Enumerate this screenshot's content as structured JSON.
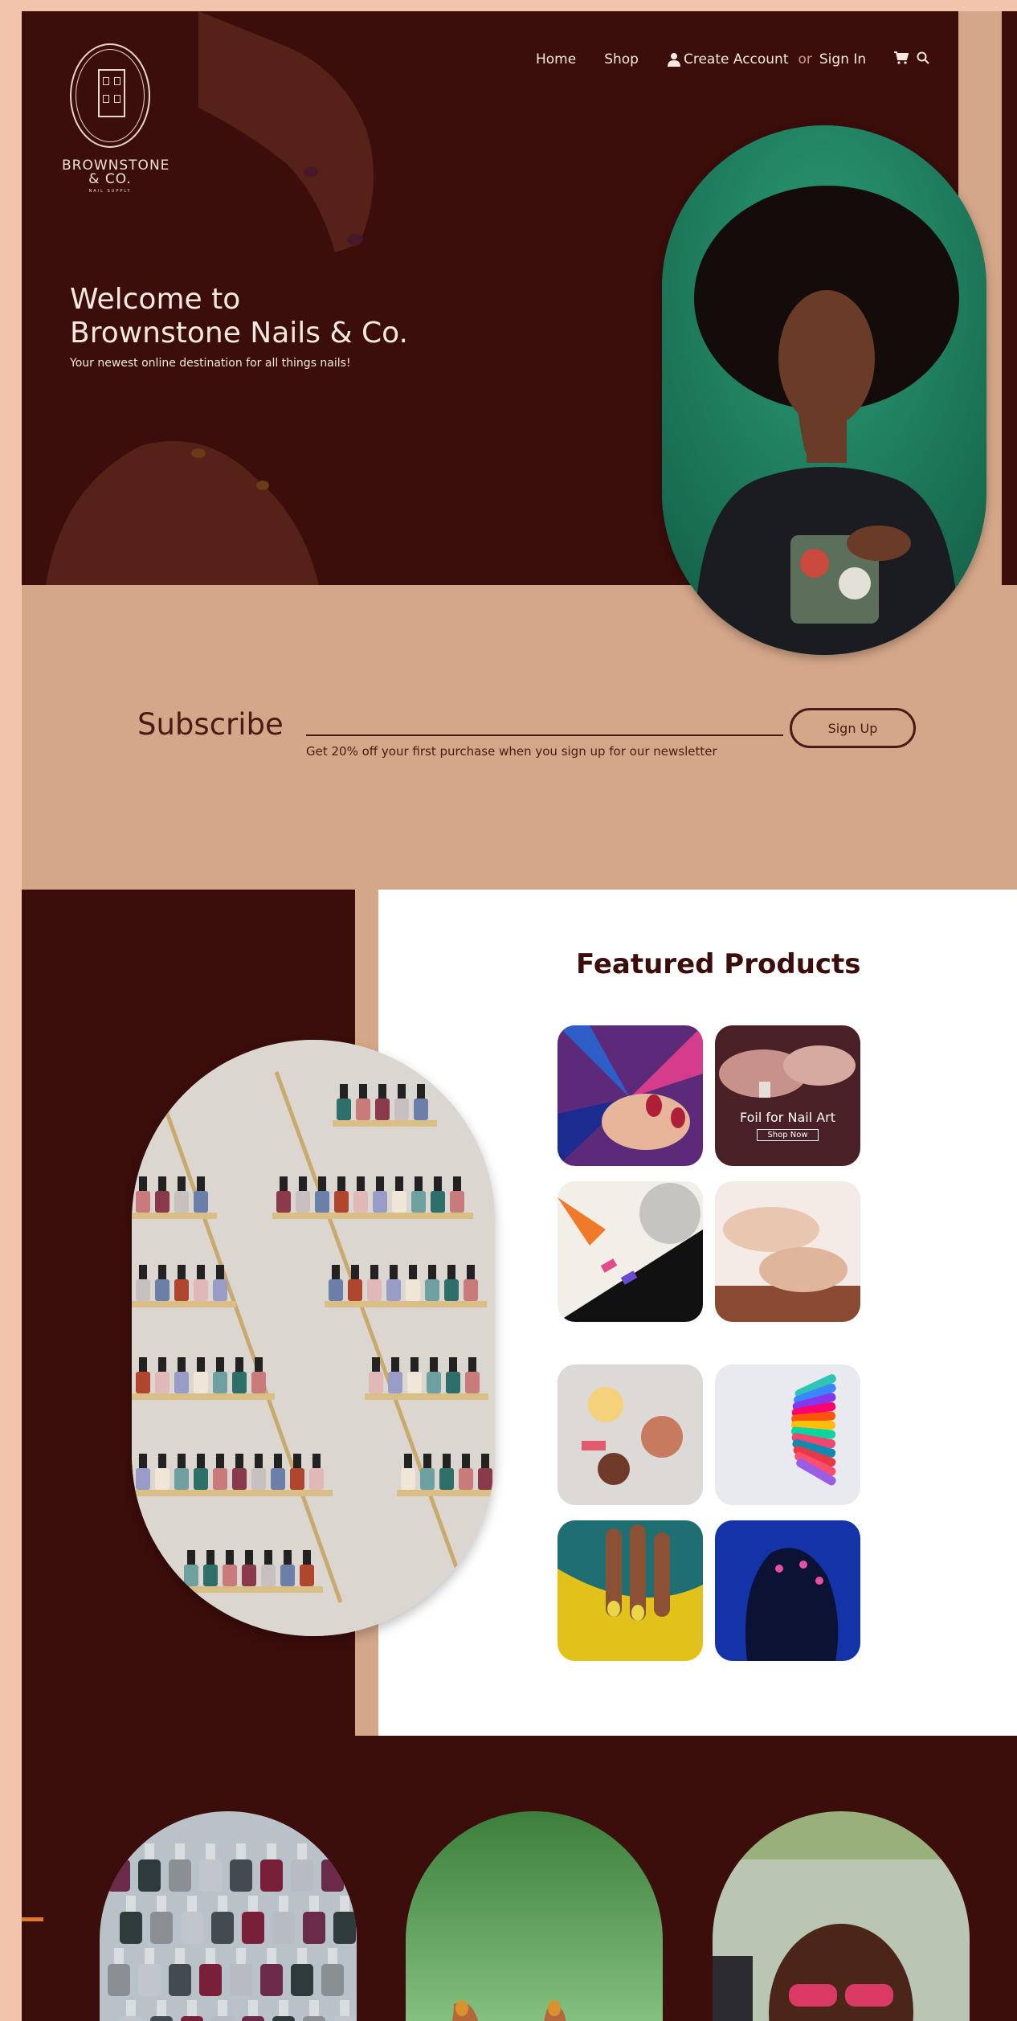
{
  "nav": {
    "home": "Home",
    "shop": "Shop",
    "create_account": "Create Account",
    "or": "or",
    "sign_in": "Sign In",
    "cart_icon": "cart-icon",
    "search_icon": "search-icon"
  },
  "logo": {
    "name_line1": "BROWNSTONE",
    "name_line2": "& CO.",
    "sub": "NAIL SUPPLY"
  },
  "hero": {
    "title_line1": "Welcome to",
    "title_line2": "Brownstone Nails & Co.",
    "tagline": "Your newest online destination for all things nails!"
  },
  "subscribe": {
    "title": "Subscribe",
    "note": "Get 20% off your first purchase when you sign up for our newsletter",
    "button": "Sign Up"
  },
  "featured": {
    "title": "Featured Products",
    "overlay_title": "Foil for Nail Art",
    "overlay_button": "Shop Now"
  },
  "colors": {
    "maroon": "#3b0d0b",
    "tan": "#d5a789",
    "background": "#f2c4ab",
    "accent_orange": "#e0782a"
  }
}
